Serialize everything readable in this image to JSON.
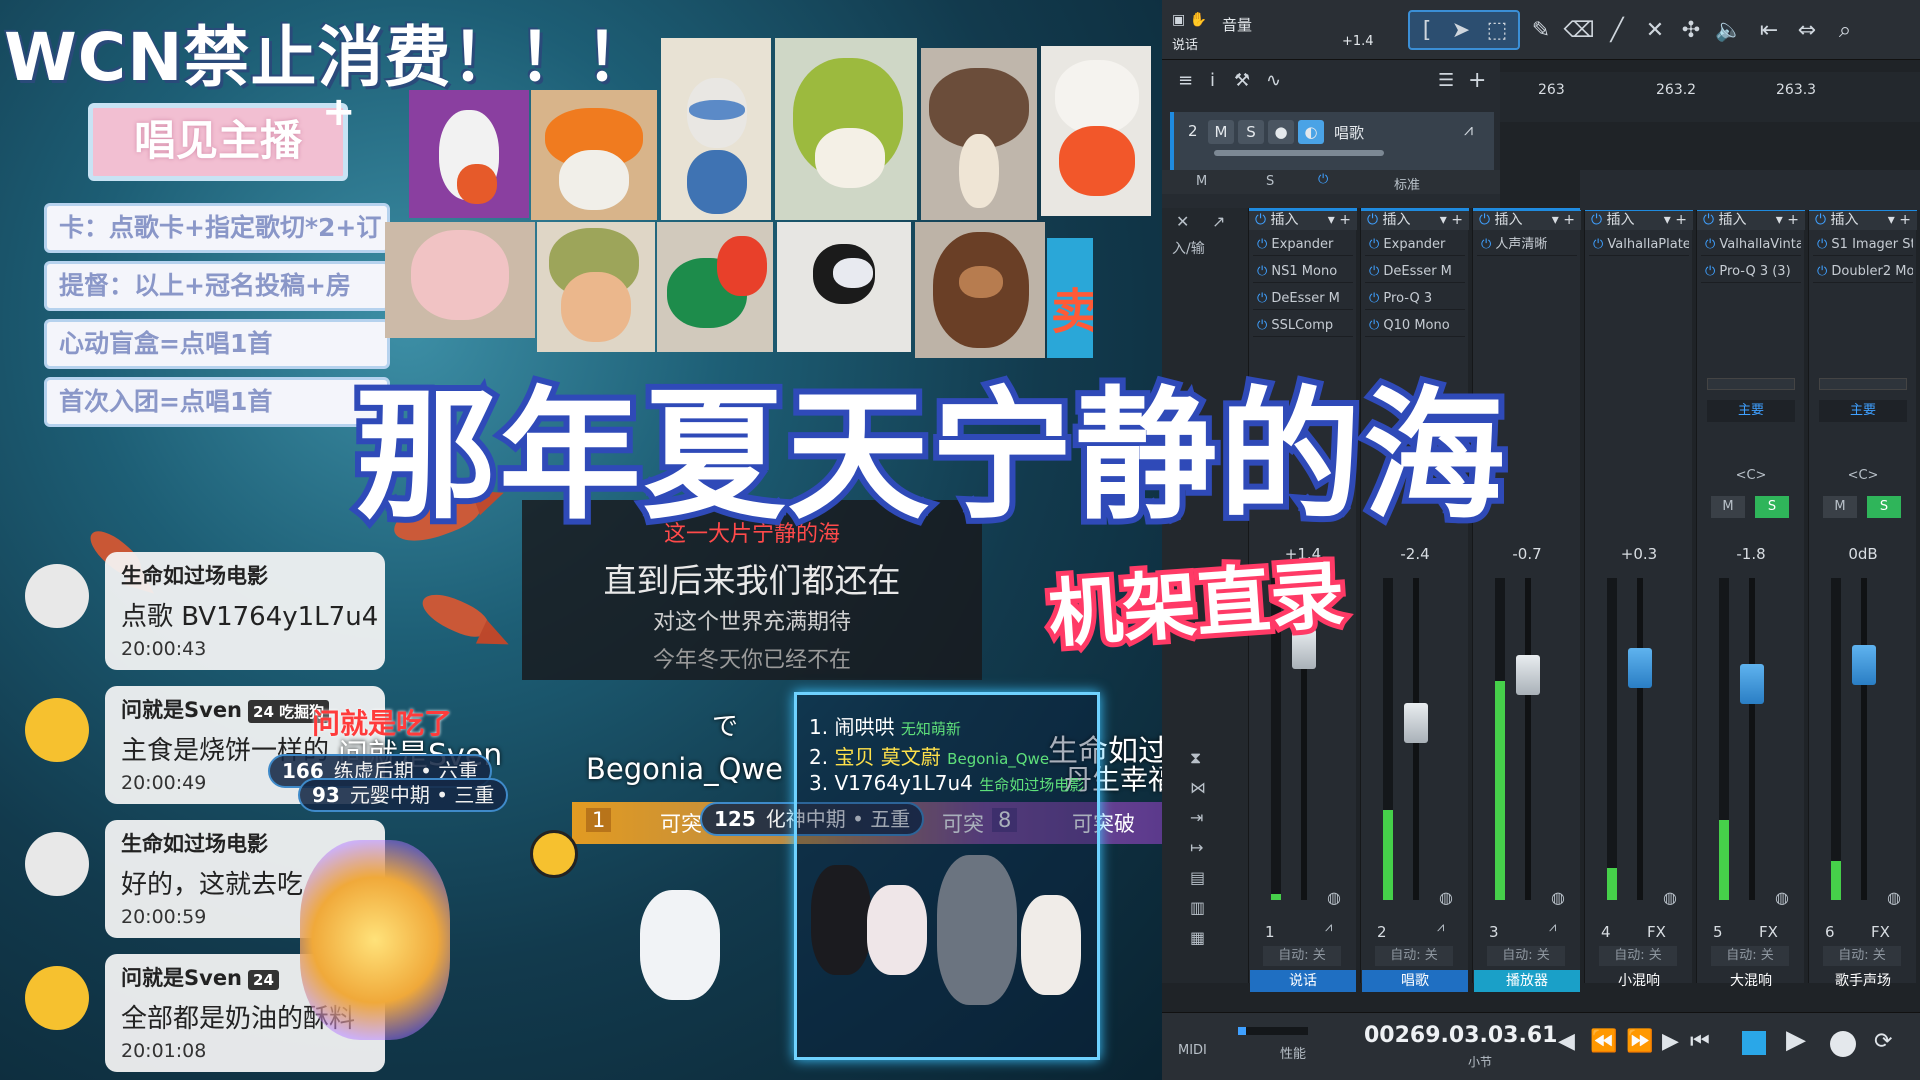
{
  "banner": {
    "text": "WCN禁止消费！！！"
  },
  "menu": {
    "title": "唱见主播",
    "plus": "+",
    "rows": [
      "卡：点歌卡+指定歌切*2+订",
      "提督：以上+冠名投稿+房",
      "心动盲盒=点唱1首",
      "首次入团=点唱1首"
    ]
  },
  "side_sign": "卖",
  "lyrics": {
    "line1": "这一大片宁静的海",
    "line2": "直到后来我们都还在",
    "line3": "对这个世界充满期待",
    "line4": "今年冬天你已经不在"
  },
  "title": {
    "main": "那年夏天宁静的海",
    "sub": "机架直录"
  },
  "chat": [
    {
      "name": "生命如过场电影",
      "badge": "",
      "message": "点歌 BV1764y1L7u4",
      "time": "20:00:43"
    },
    {
      "name": "问就是Sven",
      "badge": "24 吃掘狗",
      "message": "主食是烧饼一样的",
      "time": "20:00:49"
    },
    {
      "name": "生命如过场电影",
      "badge": "",
      "message": "好的，这就去吃",
      "time": "20:00:59"
    },
    {
      "name": "问就是Sven",
      "badge": "24",
      "message": "全部都是奶油的酥料",
      "time": "20:01:08"
    }
  ],
  "overlays": {
    "red_chat": "问就是吃了",
    "sven_float": "问就是Sven",
    "begonia": "Begonia_Qwe",
    "right_name": "生命如过",
    "right_name2": "丹生幸福娱",
    "kan": "で"
  },
  "rank_pills": [
    {
      "num": "166",
      "text": "练虚后期 • 六重"
    },
    {
      "num": "93",
      "text": "元婴中期 • 三重"
    },
    {
      "num": "125",
      "text": "化神中期 • 五重"
    }
  ],
  "bar_strip": {
    "num1": "1",
    "label1": "可突",
    "label2": "可突",
    "num2": "8",
    "label3": "可突破"
  },
  "queue": [
    {
      "index": "1.",
      "text": "闹哄哄",
      "tag": "无知萌新"
    },
    {
      "index": "2.",
      "text": "宝贝 莫文蔚",
      "tag": "Begonia_Qwe"
    },
    {
      "index": "3.",
      "text": "V1764y1L7u4",
      "tag": "生命如过场电影"
    }
  ],
  "daw": {
    "header_label1": "音量",
    "header_label2": "说话",
    "header_value": "+1.4",
    "ruler": [
      "263",
      "263.2",
      "263.3"
    ],
    "track": {
      "num": "2",
      "m": "M",
      "s": "S",
      "name": "唱歌"
    },
    "row2": {
      "m": "M",
      "s": "S",
      "mode": "标准"
    },
    "io_label": "入/输",
    "channels": [
      {
        "header": "插入",
        "slots": [
          "Expander",
          "NS1 Mono",
          "DeEsser M",
          "SSLComp"
        ],
        "gain": "+1.4",
        "num": "1",
        "auto": "自动: 关",
        "name": "说话",
        "color": "#1f6fc2",
        "meter": 0.02,
        "fader": 0.78
      },
      {
        "header": "插入",
        "slots": [
          "Expander",
          "DeEsser M",
          "Pro-Q 3",
          "Q10 Mono"
        ],
        "gain": "-2.4",
        "num": "2",
        "auto": "自动: 关",
        "name": "唱歌",
        "color": "#1f6fc2",
        "meter": 0.28,
        "fader": 0.55
      },
      {
        "header": "插入",
        "slots": [
          "人声清晰"
        ],
        "gain": "-0.7",
        "num": "3",
        "auto": "自动: 关",
        "name": "播放器",
        "color": "#1aa0c8",
        "meter": 0.68,
        "fader": 0.7
      },
      {
        "header": "插入",
        "slots": [
          "ValhallaPlate"
        ],
        "gain": "+0.3",
        "num": "4",
        "auto": "自动: 关",
        "name": "小混响",
        "color": "",
        "meter": 0.1,
        "fader": 0.72
      },
      {
        "header": "插入",
        "slots": [
          "ValhallaVinta",
          "Pro-Q 3 (3)"
        ],
        "gain": "-1.8",
        "num": "5",
        "auto": "自动: 关",
        "name": "大混响",
        "color": "",
        "meter": 0.25,
        "fader": 0.67
      },
      {
        "header": "插入",
        "slots": [
          "S1 Imager St",
          "Doubler2 Mo"
        ],
        "gain": "0dB",
        "num": "6",
        "auto": "自动: 关",
        "name": "歌手声场",
        "color": "",
        "meter": 0.12,
        "fader": 0.73
      }
    ],
    "bus_label": "主要",
    "bus_center": "<C>",
    "fx": "FX",
    "transport": {
      "timecode": "00269.03.03.61",
      "unit": "小节",
      "midi": "MIDI",
      "perf": "性能"
    }
  }
}
